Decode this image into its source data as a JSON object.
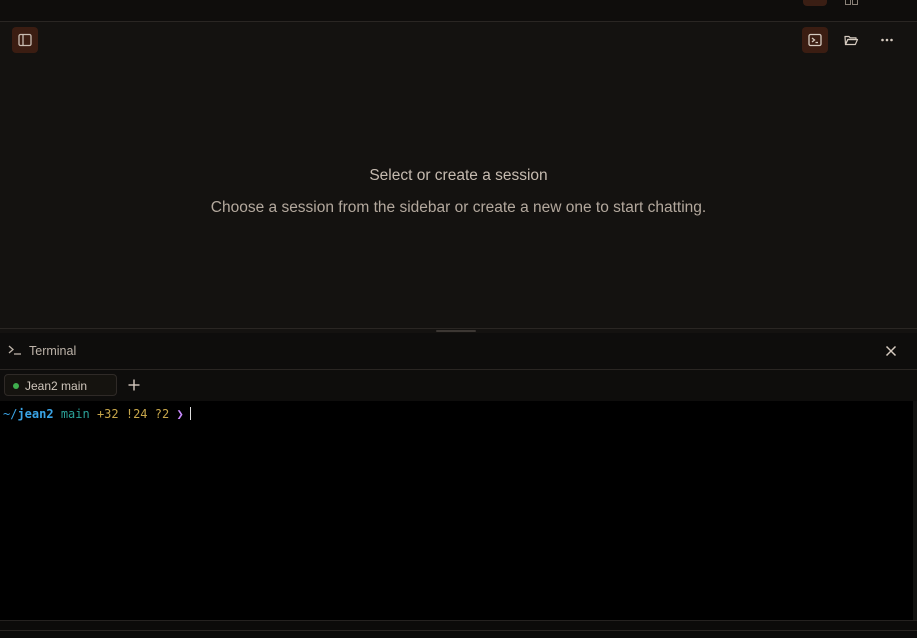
{
  "header": {
    "sidebar_toggle_icon": "sidebar-toggle-icon",
    "actions": [
      {
        "icon": "terminal-icon",
        "active": true
      },
      {
        "icon": "folder-open-icon",
        "active": false
      },
      {
        "icon": "more-horizontal-icon",
        "active": false
      }
    ]
  },
  "main": {
    "empty_title": "Select or create a session",
    "empty_subtitle": "Choose a session from the sidebar or create a new one to start chatting."
  },
  "terminal_panel": {
    "title": "Terminal",
    "tabs": [
      {
        "label": "Jean2 main",
        "status_color": "#3fae4e"
      }
    ],
    "prompt": {
      "path_prefix": "~/",
      "path_dir": "jean2",
      "branch": "main",
      "status": "+32 !24 ?2",
      "arrow": "❯"
    }
  },
  "colors": {
    "accent_active_bg": "#3b1d12",
    "background": "#141210",
    "terminal_bg": "#000000"
  }
}
